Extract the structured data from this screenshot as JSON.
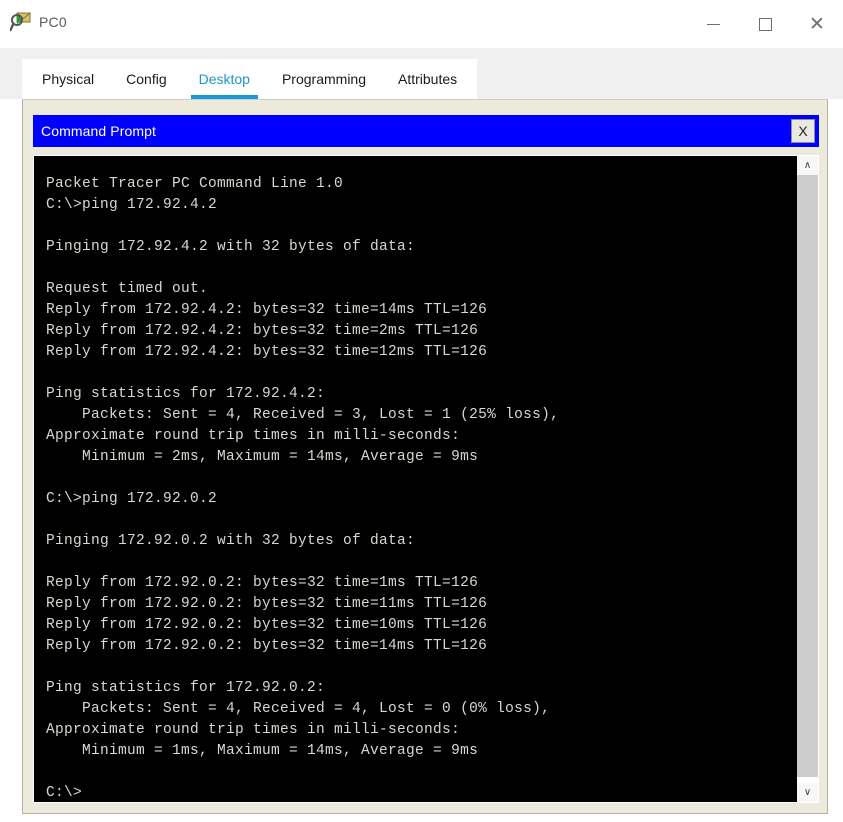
{
  "window": {
    "title": "PC0",
    "icon": "packet-tracer-icon",
    "controls": {
      "minimize": "—",
      "maximize": "☐",
      "close": "×"
    }
  },
  "tabs": [
    {
      "label": "Physical",
      "active": false
    },
    {
      "label": "Config",
      "active": false
    },
    {
      "label": "Desktop",
      "active": true
    },
    {
      "label": "Programming",
      "active": false
    },
    {
      "label": "Attributes",
      "active": false
    }
  ],
  "command_prompt": {
    "title": "Command Prompt",
    "close_label": "X",
    "accent_color": "#0000ff",
    "terminal_bg": "#000000",
    "terminal_fg": "#d8d8d0",
    "output": "Packet Tracer PC Command Line 1.0\nC:\\>ping 172.92.4.2\n\nPinging 172.92.4.2 with 32 bytes of data:\n\nRequest timed out.\nReply from 172.92.4.2: bytes=32 time=14ms TTL=126\nReply from 172.92.4.2: bytes=32 time=2ms TTL=126\nReply from 172.92.4.2: bytes=32 time=12ms TTL=126\n\nPing statistics for 172.92.4.2:\n    Packets: Sent = 4, Received = 3, Lost = 1 (25% loss),\nApproximate round trip times in milli-seconds:\n    Minimum = 2ms, Maximum = 14ms, Average = 9ms\n\nC:\\>ping 172.92.0.2\n\nPinging 172.92.0.2 with 32 bytes of data:\n\nReply from 172.92.0.2: bytes=32 time=1ms TTL=126\nReply from 172.92.0.2: bytes=32 time=11ms TTL=126\nReply from 172.92.0.2: bytes=32 time=10ms TTL=126\nReply from 172.92.0.2: bytes=32 time=14ms TTL=126\n\nPing statistics for 172.92.0.2:\n    Packets: Sent = 4, Received = 4, Lost = 0 (0% loss),\nApproximate round trip times in milli-seconds:\n    Minimum = 1ms, Maximum = 14ms, Average = 9ms\n\nC:\\>",
    "scrollbar": {
      "up_arrow": "∧",
      "down_arrow": "∨"
    }
  }
}
